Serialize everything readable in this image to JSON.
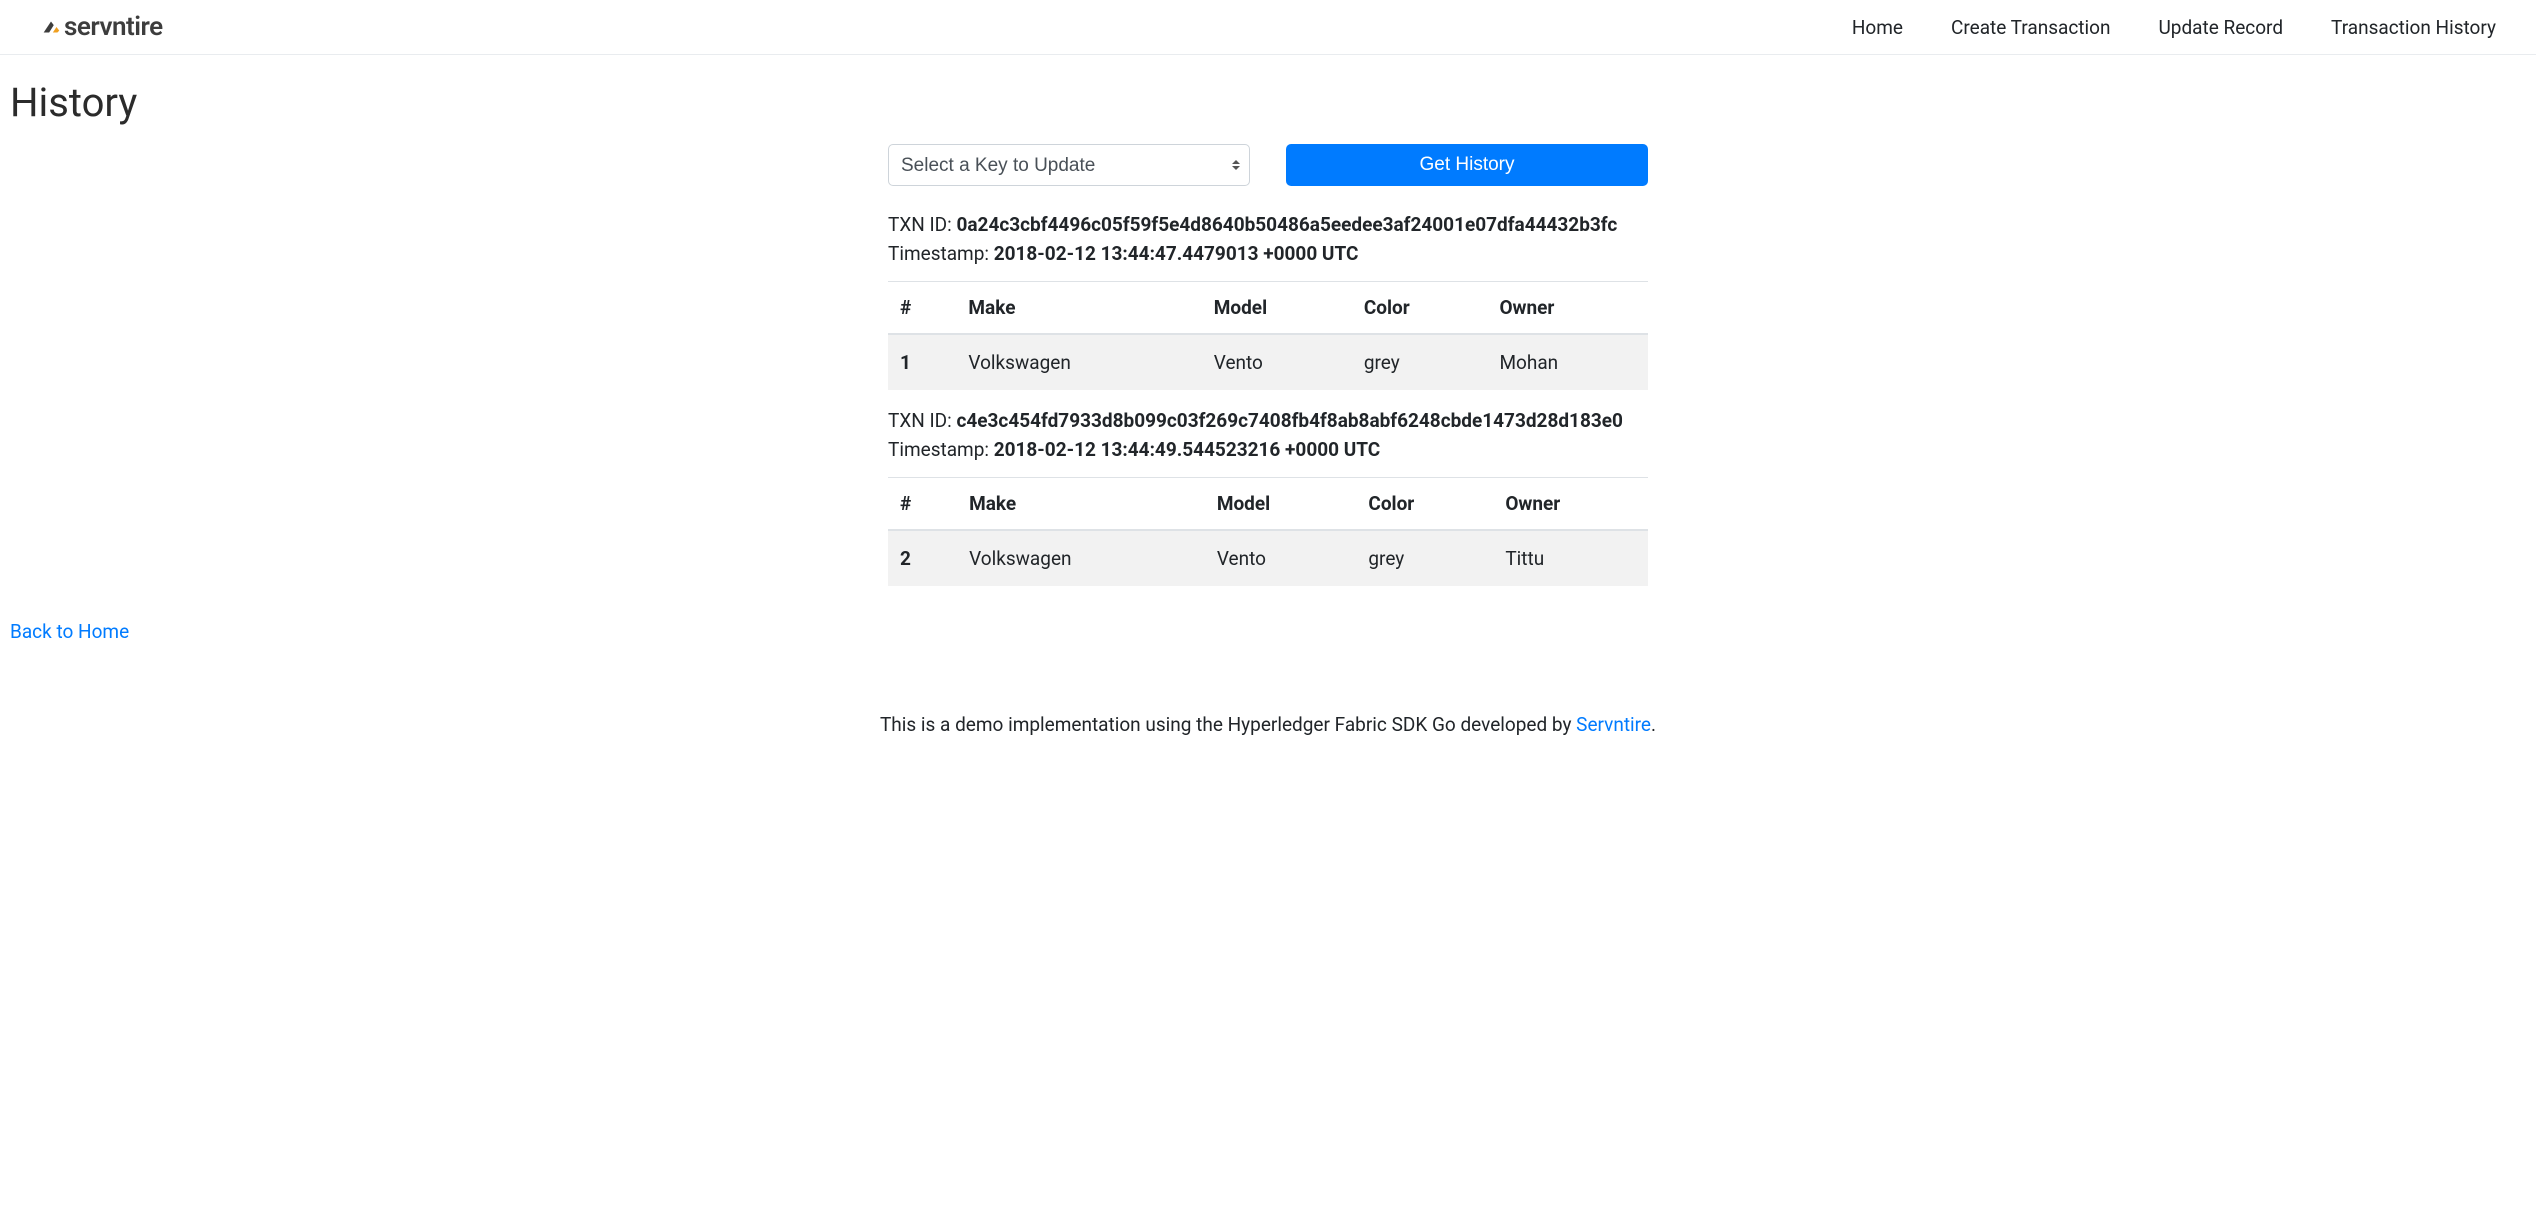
{
  "brand": {
    "name": "servntire"
  },
  "nav": {
    "home": "Home",
    "create_transaction": "Create Transaction",
    "update_record": "Update Record",
    "transaction_history": "Transaction History"
  },
  "page": {
    "title": "History",
    "select_placeholder": "Select a Key to Update",
    "get_history_button": "Get History",
    "back_link": "Back to Home"
  },
  "labels": {
    "txn_id": "TXN ID: ",
    "timestamp": "Timestamp: "
  },
  "columns": {
    "index": "#",
    "make": "Make",
    "model": "Model",
    "color": "Color",
    "owner": "Owner"
  },
  "transactions": [
    {
      "txn_id": "0a24c3cbf4496c05f59f5e4d8640b50486a5eedee3af24001e07dfa44432b3fc",
      "timestamp": "2018-02-12 13:44:47.4479013 +0000 UTC",
      "row": {
        "index": "1",
        "make": "Volkswagen",
        "model": "Vento",
        "color": "grey",
        "owner": "Mohan"
      }
    },
    {
      "txn_id": "c4e3c454fd7933d8b099c03f269c7408fb4f8ab8abf6248cbde1473d28d183e0",
      "timestamp": "2018-02-12 13:44:49.544523216 +0000 UTC",
      "row": {
        "index": "2",
        "make": "Volkswagen",
        "model": "Vento",
        "color": "grey",
        "owner": "Tittu"
      }
    }
  ],
  "footer": {
    "text_before": "This is a demo implementation using the Hyperledger Fabric SDK Go developed by ",
    "link_text": "Servntire",
    "text_after": "."
  }
}
